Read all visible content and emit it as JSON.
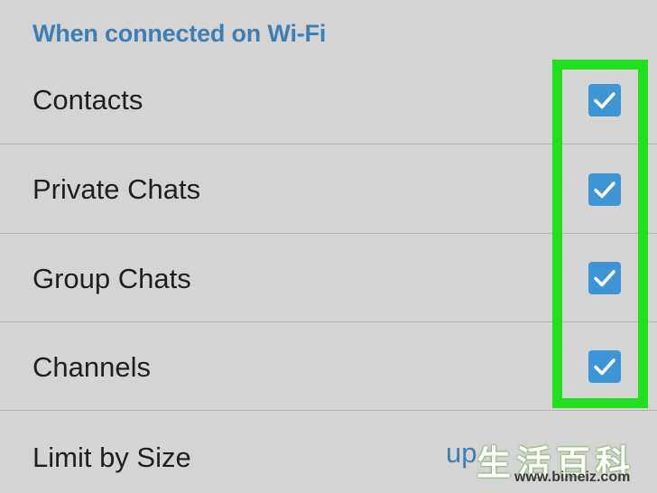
{
  "section": {
    "title": "When connected on Wi-Fi"
  },
  "rows": [
    {
      "label": "Contacts",
      "checked": true
    },
    {
      "label": "Private Chats",
      "checked": true
    },
    {
      "label": "Group Chats",
      "checked": true
    },
    {
      "label": "Channels",
      "checked": true
    }
  ],
  "limit": {
    "label": "Limit by Size",
    "value": "up"
  },
  "watermark": {
    "chars": "生活百科",
    "url": "www.bimeiz.com"
  },
  "colors": {
    "accent": "#3e95d6",
    "header": "#3d7fb5",
    "highlight": "#22e01f",
    "background": "#d4d4d4"
  },
  "icons": {
    "checkbox": "checkbox-checked-icon"
  }
}
